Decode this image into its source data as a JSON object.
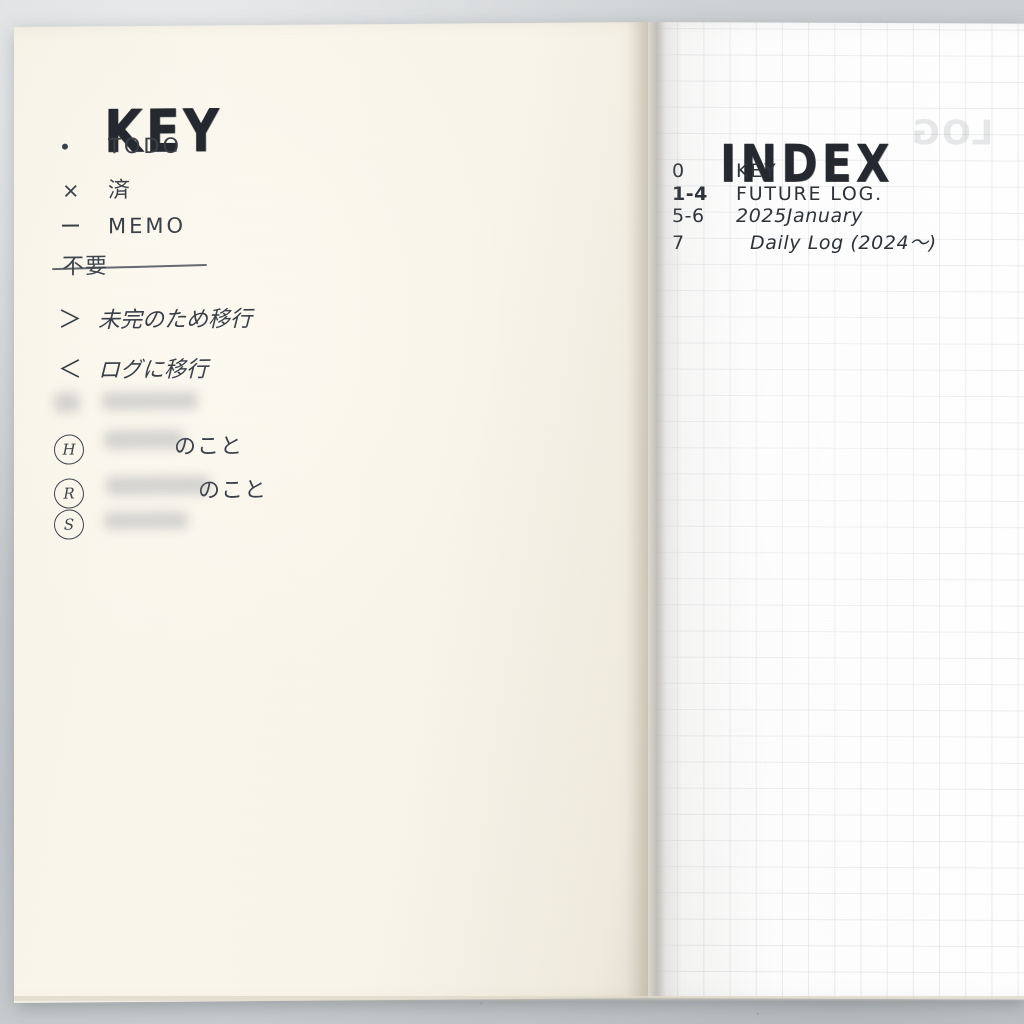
{
  "scene": {
    "description": "Open bullet journal notebook on a grey concrete surface",
    "background_color": "#c9ccce",
    "left_page_color": "#f8f4e9",
    "right_page_color": "#ffffff",
    "ink_color": "#33383f"
  },
  "left_page": {
    "heading": "KEY",
    "rows": [
      {
        "symbol": "dot",
        "symbol_text": "•",
        "text": "TODO",
        "style": "latin"
      },
      {
        "symbol": "x",
        "symbol_text": "×",
        "text": "済",
        "style": "jp"
      },
      {
        "symbol": "dash",
        "symbol_text": "—",
        "text": "MEMO",
        "style": "latin"
      },
      {
        "symbol": "gt",
        "symbol_text": "＞",
        "text": "未完のため移行",
        "style": "cursive"
      },
      {
        "symbol": "lt",
        "symbol_text": "＜",
        "text": "ログに移行",
        "style": "cursive"
      }
    ],
    "struck_row": {
      "text": "不要",
      "struck_through": true
    },
    "redacted_rows": [
      {
        "symbol_text": "",
        "visible_suffix": "",
        "redacted": true
      },
      {
        "symbol_text": "H",
        "visible_suffix": "のこと",
        "redacted": true
      },
      {
        "symbol_text": "R",
        "visible_suffix": "のこと",
        "redacted": true
      },
      {
        "symbol_text": "S",
        "visible_suffix": "",
        "redacted": true
      }
    ]
  },
  "right_page": {
    "heading": "INDEX",
    "paper_type": "grid",
    "grid_size_px": 26,
    "entries": [
      {
        "pages": "0",
        "label": "KEY",
        "style": "latin",
        "bold_pages": false,
        "indent": false
      },
      {
        "pages": "1-4",
        "label": "FUTURE LOG.",
        "style": "latin",
        "bold_pages": true,
        "indent": false
      },
      {
        "pages": "5-6",
        "label": "2025January",
        "style": "cursive",
        "bold_pages": false,
        "indent": false
      },
      {
        "pages": "7",
        "label": "Daily Log (2024～)",
        "style": "cursive",
        "bold_pages": false,
        "indent": true
      }
    ],
    "show_through_text": "LOG"
  }
}
